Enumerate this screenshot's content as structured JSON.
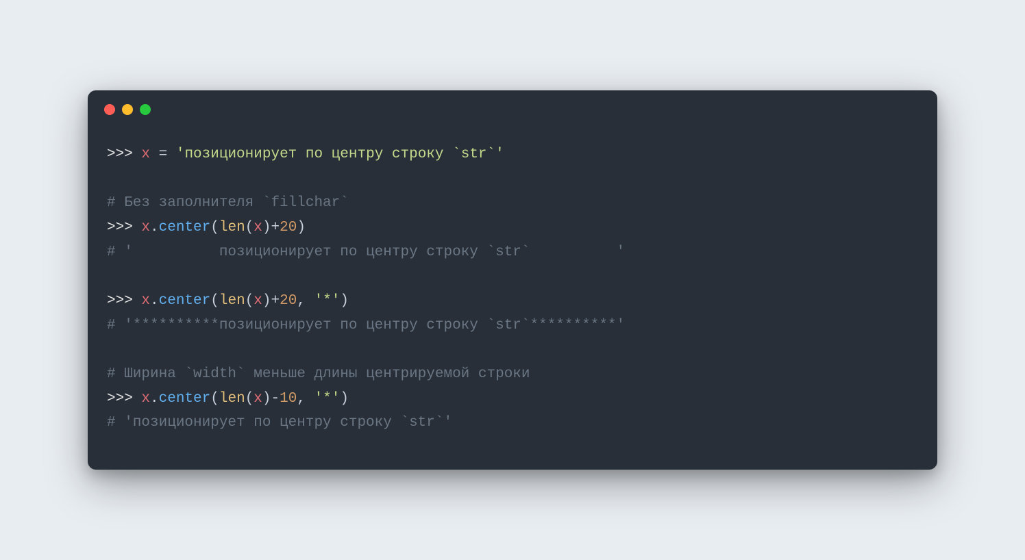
{
  "colors": {
    "bg_page": "#e8edf2",
    "bg_window": "#282f38",
    "dot_red": "#ff5f56",
    "dot_yellow": "#ffbd2e",
    "dot_green": "#27c93f",
    "prompt": "#e6e6e6",
    "variable": "#e06c75",
    "string": "#c3d98b",
    "comment": "#6a7684",
    "method": "#61afef",
    "func": "#e5c07b",
    "number": "#d19a66"
  },
  "code": {
    "line1": {
      "prompt": ">>> ",
      "var": "x",
      "eq": " = ",
      "str": "'позиционирует по центру строку `str`'"
    },
    "line2_blank": "",
    "line3_comment": "# Без заполнителя `fillchar`",
    "line4": {
      "prompt": ">>> ",
      "var1": "x",
      "dot1": ".",
      "method": "center",
      "lp1": "(",
      "func": "len",
      "lp2": "(",
      "var2": "x",
      "rp1": ")+",
      "num": "20",
      "rp2": ")"
    },
    "line5_comment": "# '          позиционирует по центру строку `str`          '",
    "line6_blank": "",
    "line7": {
      "prompt": ">>> ",
      "var1": "x",
      "dot1": ".",
      "method": "center",
      "lp1": "(",
      "func": "len",
      "lp2": "(",
      "var2": "x",
      "rp1": ")+",
      "num": "20",
      "comma": ", ",
      "arg": "'*'",
      "rp2": ")"
    },
    "line8_comment": "# '**********позиционирует по центру строку `str`**********'",
    "line9_blank": "",
    "line10_comment": "# Ширина `width` меньше длины центрируемой строки",
    "line11": {
      "prompt": ">>> ",
      "var1": "x",
      "dot1": ".",
      "method": "center",
      "lp1": "(",
      "func": "len",
      "lp2": "(",
      "var2": "x",
      "rp1": ")-",
      "num": "10",
      "comma": ", ",
      "arg": "'*'",
      "rp2": ")"
    },
    "line12_comment": "# 'позиционирует по центру строку `str`'"
  }
}
